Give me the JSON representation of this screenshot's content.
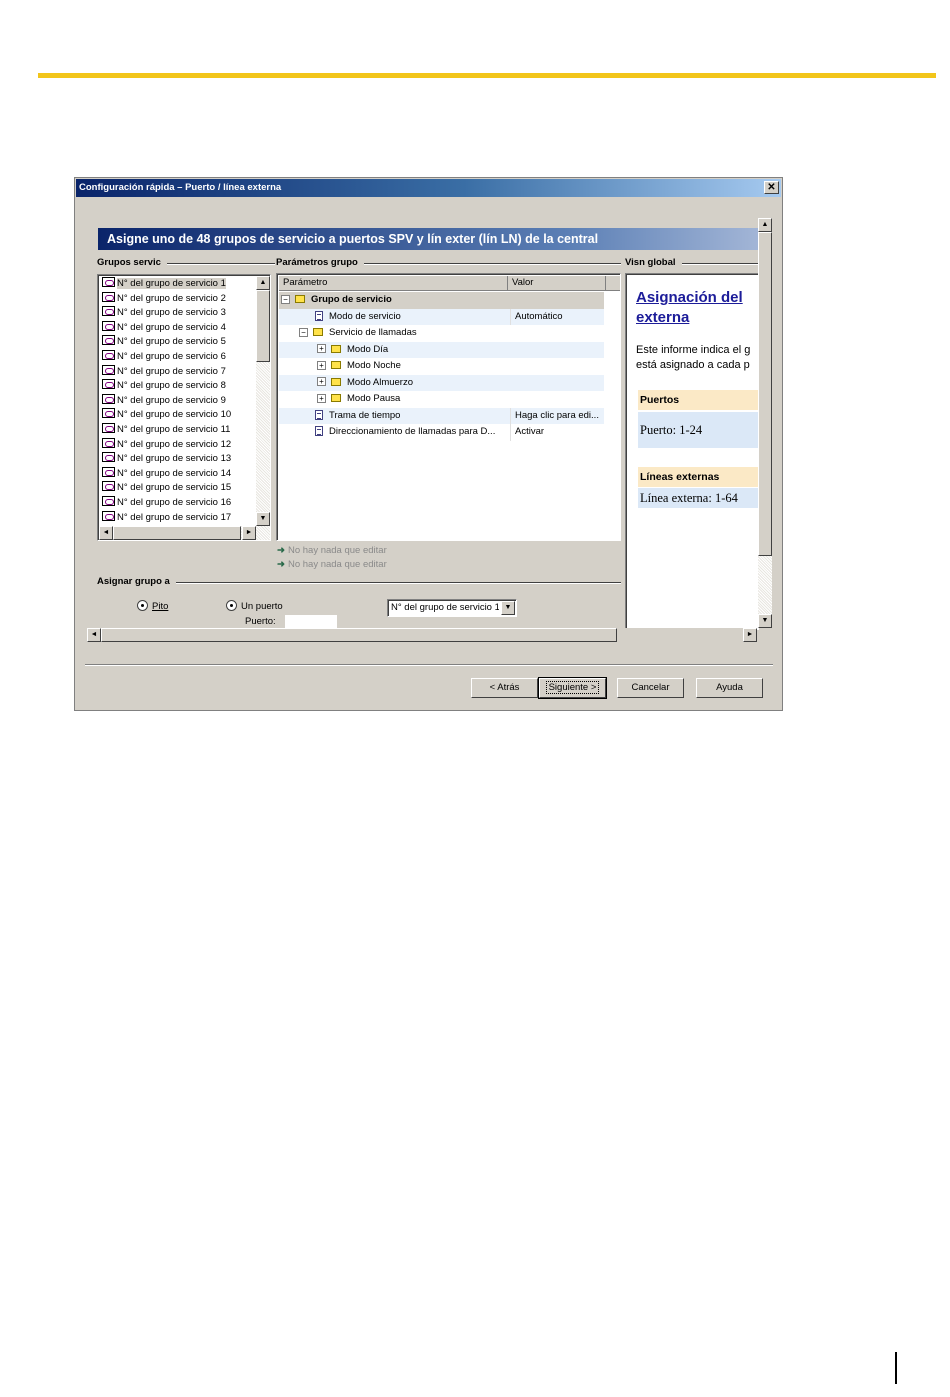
{
  "dialog": {
    "title": "Configuración rápida – Puerto / línea externa",
    "close_glyph": "✕",
    "banner": "Asigne uno de 48 grupos de servicio a puertos SPV y lín exter (lín LN) de la central"
  },
  "sections": {
    "groups": "Grupos servic",
    "params": "Parámetros grupo",
    "view": "Visn global",
    "assign": "Asignar grupo a"
  },
  "groups_list": [
    "N° del grupo de servicio 1",
    "N° del grupo de servicio 2",
    "N° del grupo de servicio 3",
    "N° del grupo de servicio 4",
    "N° del grupo de servicio 5",
    "N° del grupo de servicio 6",
    "N° del grupo de servicio 7",
    "N° del grupo de servicio 8",
    "N° del grupo de servicio 9",
    "N° del grupo de servicio 10",
    "N° del grupo de servicio 11",
    "N° del grupo de servicio 12",
    "N° del grupo de servicio 13",
    "N° del grupo de servicio 14",
    "N° del grupo de servicio 15",
    "N° del grupo de servicio 16",
    "N° del grupo de servicio 17"
  ],
  "grid": {
    "col_param": "Parámetro",
    "col_value": "Valor",
    "rows": [
      {
        "name": "Grupo de servicio",
        "value": "",
        "expander": "−",
        "icon": "folder"
      },
      {
        "name": "Modo de servicio",
        "value": "Automático",
        "expander": "",
        "icon": "doc"
      },
      {
        "name": "Servicio de llamadas",
        "value": "",
        "expander": "−",
        "icon": "folder"
      },
      {
        "name": "Modo Día",
        "value": "",
        "expander": "+",
        "icon": "folder"
      },
      {
        "name": "Modo Noche",
        "value": "",
        "expander": "+",
        "icon": "folder"
      },
      {
        "name": "Modo Almuerzo",
        "value": "",
        "expander": "+",
        "icon": "folder"
      },
      {
        "name": "Modo Pausa",
        "value": "",
        "expander": "+",
        "icon": "folder"
      },
      {
        "name": "Trama de tiempo",
        "value": "Haga clic para edi...",
        "expander": "",
        "icon": "doc"
      },
      {
        "name": "Direccionamiento de llamadas para D...",
        "value": "Activar",
        "expander": "",
        "icon": "doc"
      }
    ]
  },
  "nothing_to_edit": [
    "No hay nada que editar",
    "No hay nada que editar"
  ],
  "assign": {
    "radio_pito": "Pito",
    "radio_puerto": "Un puerto",
    "puerto_label": "Puerto:",
    "puerto_value": "",
    "group_combo": "N° del grupo de servicio 1"
  },
  "report": {
    "title_line1": "Asignación del",
    "title_line2": "externa",
    "desc_line1": "Este informe indica el g",
    "desc_line2": "está asignado a cada p",
    "ports_head": "Puertos",
    "ports_value": "Puerto: 1-24",
    "lines_head": "Líneas externas",
    "lines_value": "Línea externa: 1-64"
  },
  "buttons": {
    "back": "< Atrás",
    "next": "Siguiente >",
    "cancel": "Cancelar",
    "help": "Ayuda"
  },
  "scroll_glyphs": {
    "up": "▲",
    "down": "▼",
    "left": "◄",
    "right": "►"
  },
  "colors": {
    "page_rule": "#f2c51a",
    "banner": "#0a246a",
    "report_link": "#1c1c99",
    "report_head": "#fbe9c6",
    "report_cell": "#dbe8f7"
  }
}
